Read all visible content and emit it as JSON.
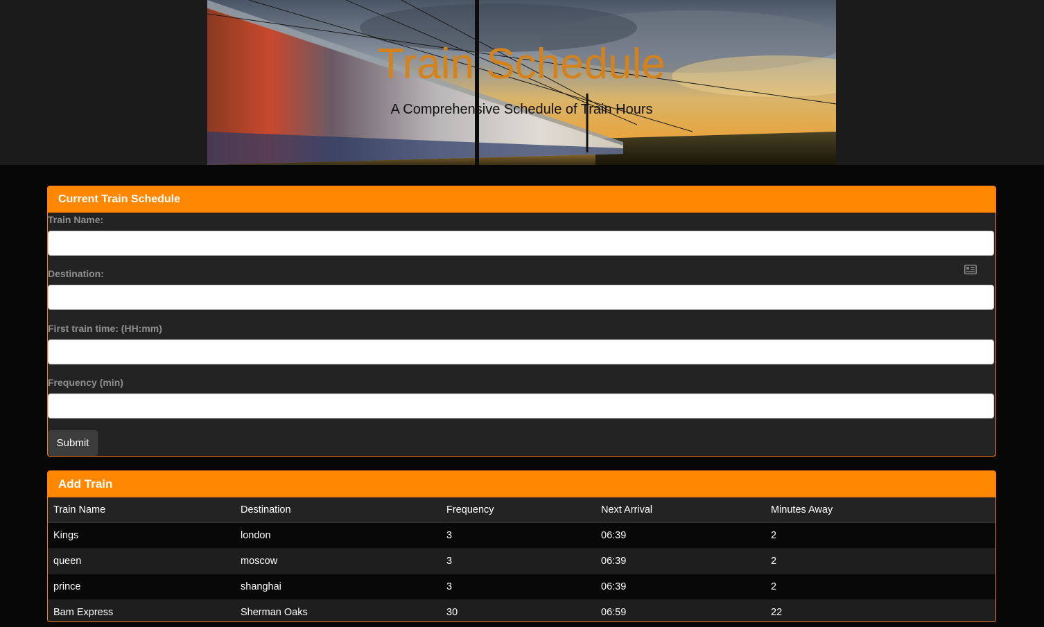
{
  "header": {
    "title": "Train Schedule",
    "subtitle": "A Comprehensive Schedule of Train Hours"
  },
  "form_panel": {
    "heading": "Current Train Schedule",
    "fields": [
      {
        "label": "Train Name:",
        "value": "",
        "placeholder": ""
      },
      {
        "label": "Destination:",
        "value": "",
        "placeholder": ""
      },
      {
        "label": "First train time: (HH:mm)",
        "value": "",
        "placeholder": ""
      },
      {
        "label": "Frequency (min)",
        "value": "",
        "placeholder": ""
      }
    ],
    "submit_label": "Submit"
  },
  "table_panel": {
    "heading": "Add Train",
    "columns": [
      "Train Name",
      "Destination",
      "Frequency",
      "Next Arrival",
      "Minutes Away"
    ],
    "rows": [
      [
        "Kings",
        "london",
        "3",
        "06:39",
        "2"
      ],
      [
        "queen",
        "moscow",
        "3",
        "06:39",
        "2"
      ],
      [
        "prince",
        "shanghai",
        "3",
        "06:39",
        "2"
      ],
      [
        "Bam Express",
        "Sherman Oaks",
        "30",
        "06:59",
        "22"
      ]
    ]
  },
  "colors": {
    "accent": "#ff8800",
    "title": "#d4821c",
    "panel_bg": "#232323",
    "page_bg": "#070707"
  },
  "icons": {
    "autofill": "contact-card-icon"
  }
}
